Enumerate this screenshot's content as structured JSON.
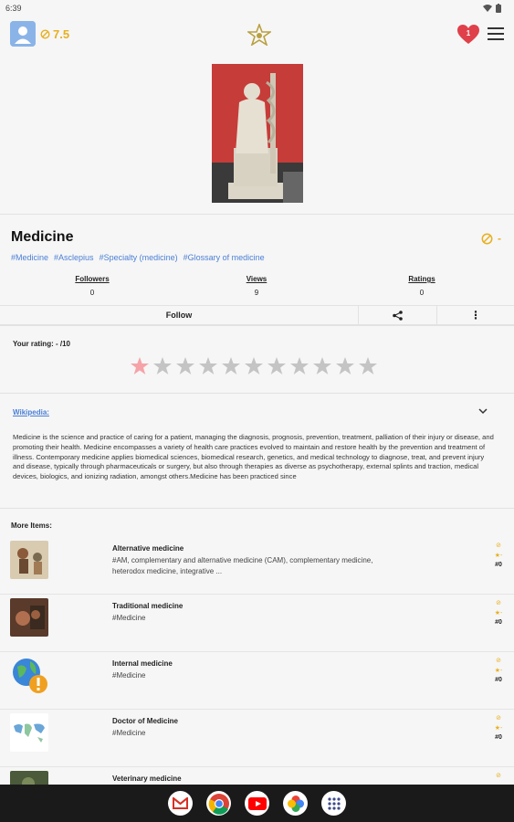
{
  "status_bar": {
    "time": "6:39"
  },
  "top_bar": {
    "user_score": "7.5"
  },
  "page": {
    "title": "Medicine",
    "rating": "-"
  },
  "tags": [
    "#Medicine",
    "#Asclepius",
    "#Specialty (medicine)",
    "#Glossary of medicine"
  ],
  "stats": [
    {
      "label": "Followers",
      "value": "0"
    },
    {
      "label": "Views",
      "value": "9"
    },
    {
      "label": "Ratings",
      "value": "0"
    }
  ],
  "actions": {
    "follow_label": "Follow",
    "more_label": "⋮"
  },
  "your_rating": {
    "label": "Your rating: - /10",
    "stars_total": 11,
    "stars_highlighted": 1
  },
  "wikipedia": {
    "label": "Wikipedia:",
    "text": "Medicine is the science and practice of caring for a patient, managing the diagnosis, prognosis, prevention, treatment, palliation of their injury or disease, and promoting their health. Medicine encompasses a variety of health care practices evolved to maintain and restore health by the prevention and treatment of illness. Contemporary medicine applies biomedical sciences, biomedical research, genetics, and medical technology to diagnose, treat, and prevent injury and disease, typically through pharmaceuticals or surgery, but also through therapies as diverse as psychotherapy, external splints and traction, medical devices, biologics, and ionizing radiation, amongst others.Medicine has been practiced since"
  },
  "more_items": {
    "label": "More Items:",
    "items": [
      {
        "name": "Alternative medicine",
        "desc": "#AM, complementary and alternative medicine (CAM), complementary medicine, heterodox medicine, integrative ...",
        "count": "#0"
      },
      {
        "name": "Traditional medicine",
        "desc": "#Medicine",
        "count": "#0"
      },
      {
        "name": "Internal medicine",
        "desc": "#Medicine",
        "count": "#0"
      },
      {
        "name": "Doctor of Medicine",
        "desc": "#Medicine",
        "count": "#0"
      },
      {
        "name": "Veterinary medicine",
        "desc": "",
        "count": ""
      }
    ]
  },
  "colors": {
    "accent": "#e8b020",
    "link": "#4a7fd6",
    "heart": "#e0404a"
  }
}
